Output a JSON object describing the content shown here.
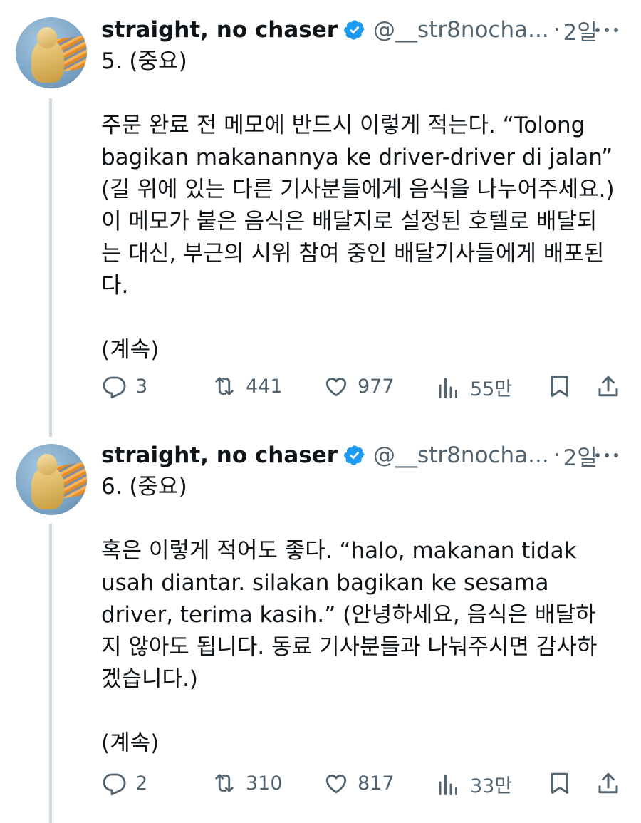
{
  "tweets": [
    {
      "author": {
        "name": "straight, no chaser",
        "handle": "@__str8nocha...",
        "time": "2일"
      },
      "number_label": "5. (중요)",
      "lines": [
        "주문 완료 전 메모에 반드시 이렇게 적는다. “Tolong",
        "bagikan makanannya ke driver-driver di jalan”",
        "(길 위에 있는 다른 기사분들에게 음식을 나누어주세요.)",
        "이 메모가 붙은 음식은 배달지로 설정된 호텔로 배달되",
        "는 대신, 부근의 시위 참여 중인 배달기사들에게 배포된",
        "다."
      ],
      "continue_label": "(계속)",
      "stats": {
        "replies": "3",
        "reposts": "441",
        "likes": "977",
        "views": "55만"
      }
    },
    {
      "author": {
        "name": "straight, no chaser",
        "handle": "@__str8nocha...",
        "time": "2일"
      },
      "number_label": "6. (중요)",
      "lines": [
        "혹은 이렇게 적어도 좋다. “halo, makanan tidak",
        "usah diantar. silakan bagikan ke sesama",
        "driver, terima kasih.” (안녕하세요, 음식은 배달하",
        "지 않아도 됩니다. 동료 기사분들과 나눠주시면 감사하",
        "겠습니다.)"
      ],
      "continue_label": "(계속)",
      "stats": {
        "replies": "2",
        "reposts": "310",
        "likes": "817",
        "views": "33만"
      }
    }
  ],
  "colors": {
    "verified": "#1d9bf0",
    "muted": "#536471",
    "text": "#0f1419",
    "thread_line": "#cfd9de"
  },
  "icons": [
    "reply-icon",
    "repost-icon",
    "like-icon",
    "views-icon",
    "bookmark-icon",
    "share-icon",
    "verified-badge-icon",
    "more-icon"
  ]
}
